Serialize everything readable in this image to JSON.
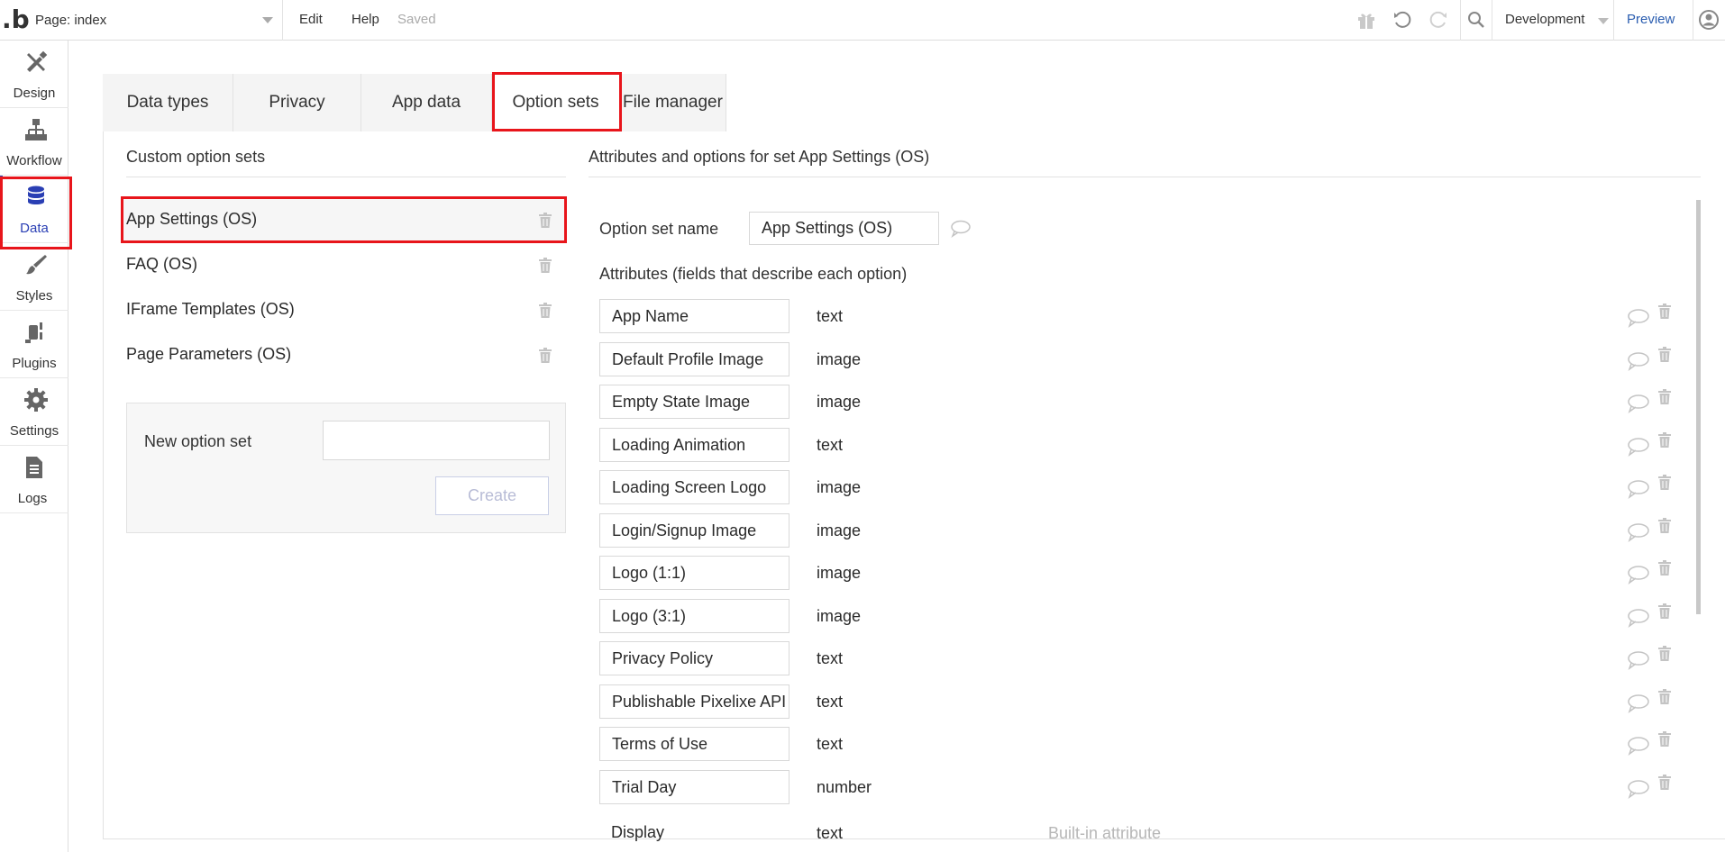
{
  "topbar": {
    "logo": ".b",
    "page_label": "Page: index",
    "menu_edit": "Edit",
    "menu_help": "Help",
    "saved_status": "Saved",
    "environment": "Development",
    "preview": "Preview"
  },
  "sidebar": {
    "items": [
      {
        "label": "Design",
        "icon": "design-icon"
      },
      {
        "label": "Workflow",
        "icon": "workflow-icon"
      },
      {
        "label": "Data",
        "icon": "database-icon",
        "active": true
      },
      {
        "label": "Styles",
        "icon": "brush-icon"
      },
      {
        "label": "Plugins",
        "icon": "plug-icon"
      },
      {
        "label": "Settings",
        "icon": "gear-icon"
      },
      {
        "label": "Logs",
        "icon": "logs-icon"
      }
    ]
  },
  "tabs": [
    {
      "label": "Data types"
    },
    {
      "label": "Privacy"
    },
    {
      "label": "App data"
    },
    {
      "label": "Option sets",
      "active": true
    },
    {
      "label": "File manager"
    }
  ],
  "option_sets": {
    "title": "Custom option sets",
    "items": [
      {
        "name": "App Settings (OS)",
        "selected": true
      },
      {
        "name": "FAQ (OS)"
      },
      {
        "name": "IFrame Templates (OS)"
      },
      {
        "name": "Page Parameters (OS)"
      }
    ],
    "new_label": "New option set",
    "new_value": "",
    "create_button": "Create"
  },
  "detail": {
    "title": "Attributes and options for set App Settings (OS)",
    "name_label": "Option set name",
    "name_value": "App Settings (OS)",
    "attributes_label": "Attributes (fields that describe each option)",
    "attributes": [
      {
        "name": "App Name",
        "type": "text"
      },
      {
        "name": "Default Profile Image",
        "type": "image"
      },
      {
        "name": "Empty State Image",
        "type": "image"
      },
      {
        "name": "Loading Animation",
        "type": "text"
      },
      {
        "name": "Loading Screen Logo",
        "type": "image"
      },
      {
        "name": "Login/Signup Image",
        "type": "image"
      },
      {
        "name": "Logo (1:1)",
        "type": "image"
      },
      {
        "name": "Logo (3:1)",
        "type": "image"
      },
      {
        "name": "Privacy Policy",
        "type": "text"
      },
      {
        "name": "Publishable Pixelixe API",
        "type": "text"
      },
      {
        "name": "Terms of Use",
        "type": "text"
      },
      {
        "name": "Trial Day",
        "type": "number"
      }
    ],
    "builtin": {
      "name": "Display",
      "type": "text",
      "note": "Built-in attribute"
    }
  },
  "colors": {
    "accent": "#2a3fb4",
    "highlight": "#e8151b",
    "link": "#2a5db0"
  }
}
